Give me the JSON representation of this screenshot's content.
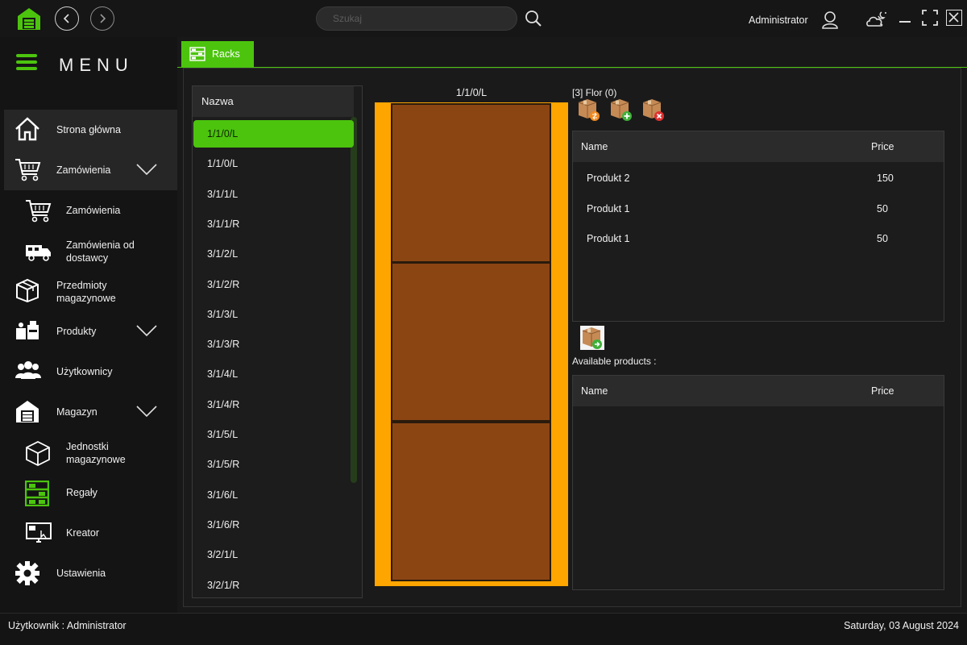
{
  "topbar": {
    "search_placeholder": "Szukaj",
    "user": "Administrator",
    "icons": [
      "warehouse-logo-icon",
      "back-icon",
      "forward-icon",
      "search-icon",
      "user-icon",
      "theme-icon",
      "minimize-icon",
      "maximize-icon",
      "close-icon"
    ]
  },
  "sidebar": {
    "title": "MENU",
    "items": {
      "home": "Strona główna",
      "orders": "Zamówienia",
      "orders_sub": "Zamówienia",
      "supplier_orders": "Zamówienia od dostawcy",
      "stock_items": "Przedmioty magazynowe",
      "products": "Produkty",
      "users": "Użytkownicy",
      "warehouse": "Magazyn",
      "units": "Jednostki magazynowe",
      "racks": "Regały",
      "creator": "Kreator",
      "settings": "Ustawienia"
    }
  },
  "tab": {
    "label": "Racks"
  },
  "racks": {
    "header": "Nazwa",
    "rows": [
      "1/1/0/L",
      "1/1/0/L",
      "3/1/1/L",
      "3/1/1/R",
      "3/1/2/L",
      "3/1/2/R",
      "3/1/3/L",
      "3/1/3/R",
      "3/1/4/L",
      "3/1/4/R",
      "3/1/5/L",
      "3/1/5/R",
      "3/1/6/L",
      "3/1/6/R",
      "3/2/1/L",
      "3/2/1/R"
    ],
    "selected_index": 0
  },
  "rack_view": {
    "title": "1/1/0/L"
  },
  "floor": {
    "label": "[3] Flor (0)",
    "table": {
      "columns": [
        "Name",
        "Price"
      ],
      "rows": [
        {
          "name": "Produkt 2",
          "price": "150"
        },
        {
          "name": "Produkt 1",
          "price": "50"
        },
        {
          "name": "Produkt 1",
          "price": "50"
        }
      ]
    }
  },
  "available": {
    "label": "Available products :",
    "table": {
      "columns": [
        "Name",
        "Price"
      ]
    }
  },
  "statusbar": {
    "user": "Użytkownik : Administrator",
    "date": "Saturday, 03 August 2024"
  },
  "colors": {
    "accent": "#4cc40e",
    "rack_frame": "#ffa500",
    "shelf": "#8b4513"
  }
}
